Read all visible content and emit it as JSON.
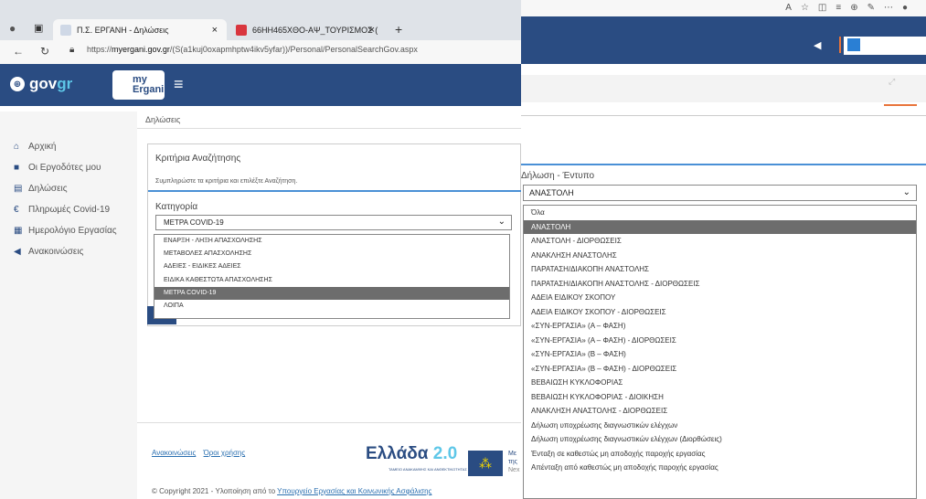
{
  "browser": {
    "tabs": [
      {
        "label": "Π.Σ. ΕΡΓΑΝΗ - Δηλώσεις"
      },
      {
        "label": "66ΗΗ465ΧΘΟ-ΑΨ_ΤΟΥΡΙΣΜΟΣ ("
      }
    ],
    "new_tab": "+",
    "url_prefix": "https://",
    "url_host": "myergani.gov.gr",
    "url_path": "/(S(a1kuj0oxapmhptw4ikv5yfar))/Personal/PersonalSearchGov.aspx"
  },
  "header": {
    "govgr_gov": "gov",
    "govgr_gr": "gr",
    "ergani_my": "my",
    "ergani_name": "Ergani"
  },
  "sidebar": {
    "items": [
      {
        "label": "Αρχική",
        "icon": "home-icon"
      },
      {
        "label": "Οι Εργοδότες μου",
        "icon": "briefcase-icon"
      },
      {
        "label": "Δηλώσεις",
        "icon": "document-icon"
      },
      {
        "label": "Πληρωμές Covid-19",
        "icon": "euro-icon"
      },
      {
        "label": "Ημερολόγιο Εργασίας",
        "icon": "calendar-icon"
      },
      {
        "label": "Ανακοινώσεις",
        "icon": "megaphone-icon"
      }
    ]
  },
  "breadcrumb": "Δηλώσεις",
  "search_panel": {
    "title": "Κριτήρια Αναζήτησης",
    "subtitle": "Συμπληρώστε τα κριτήρια και επιλέξτε Αναζήτηση.",
    "category_label": "Κατηγορία",
    "category_value": "ΜΕΤΡΑ COVID-19",
    "category_options": [
      "ΕΝΑΡΞΗ - ΛΗΞΗ ΑΠΑΣΧΟΛΗΣΗΣ",
      "ΜΕΤΑΒΟΛΕΣ ΑΠΑΣΧΟΛΗΣΗΣ",
      "ΑΔΕΙΕΣ - ΕΙΔΙΚΕΣ ΑΔΕΙΕΣ",
      "ΕΙΔΙΚΑ ΚΑΘΕΣΤΩΤΑ ΑΠΑΣΧΟΛΗΣΗΣ",
      "ΜΕΤΡΑ COVID-19",
      "ΛΟΙΠΑ"
    ],
    "category_selected_index": 4
  },
  "footer": {
    "link_announcements": "Ανακοινώσεις",
    "link_terms": "Όροι χρήσης",
    "ellada_word": "Ελλάδα",
    "ellada_num": "2.0",
    "ellada_sub": "ΤΑΜΕΙΟ ΑΝΑΚΑΜΨΗΣ ΚΑΙ ΑΝΘΕΚΤΙΚΟΤΗΤΑΣ",
    "eu_text_1": "Με",
    "eu_text_2": "της",
    "eu_text_3": "Nex",
    "copyright_text": "© Copyright 2021 - Υλοποίηση από το ",
    "copyright_link": "Υπουργείο Εργασίας και Κοινωνικής Ασφάλισης"
  },
  "right_form": {
    "label": "Δήλωση - Έντυπο",
    "value": "ΑΝΑΣΤΟΛΗ",
    "options": [
      "Όλα",
      "ΑΝΑΣΤΟΛΗ",
      "ΑΝΑΣΤΟΛΗ - ΔΙΟΡΘΩΣΕΙΣ",
      "ΑΝΑΚΛΗΣΗ ΑΝΑΣΤΟΛΗΣ",
      "ΠΑΡΑΤΑΣΗ/ΔΙΑΚΟΠΗ ΑΝΑΣΤΟΛΗΣ",
      "ΠΑΡΑΤΑΣΗ/ΔΙΑΚΟΠΗ ΑΝΑΣΤΟΛΗΣ - ΔΙΟΡΘΩΣΕΙΣ",
      "ΑΔΕΙΑ ΕΙΔΙΚΟΥ ΣΚΟΠΟΥ",
      "ΑΔΕΙΑ ΕΙΔΙΚΟΥ ΣΚΟΠΟΥ - ΔΙΟΡΘΩΣΕΙΣ",
      "«ΣΥΝ-ΕΡΓΑΣΙΑ» (Α – ΦΑΣΗ)",
      "«ΣΥΝ-ΕΡΓΑΣΙΑ» (Α – ΦΑΣΗ) - ΔΙΟΡΘΩΣΕΙΣ",
      "«ΣΥΝ-ΕΡΓΑΣΙΑ» (Β – ΦΑΣΗ)",
      "«ΣΥΝ-ΕΡΓΑΣΙΑ» (Β – ΦΑΣΗ) - ΔΙΟΡΘΩΣΕΙΣ",
      "ΒΕΒΑΙΩΣΗ ΚΥΚΛΟΦΟΡΙΑΣ",
      "ΒΕΒΑΙΩΣΗ ΚΥΚΛΟΦΟΡΙΑΣ - ΔΙΟΙΚΗΣΗ",
      "ΑΝΑΚΛΗΣΗ ΑΝΑΣΤΟΛΗΣ - ΔΙΟΡΘΩΣΕΙΣ",
      "Δήλωση υποχρέωσης διαγνωστικών ελέγχων",
      "Δήλωση υποχρέωσης διαγνωστικών ελέγχων (Διορθώσεις)",
      "Ένταξη σε καθεστώς μη αποδοχής παροχής εργασίας",
      "Απένταξη από καθεστώς μη αποδοχής παροχής εργασίας"
    ],
    "selected_index": 1
  },
  "colors": {
    "brand_blue": "#2a4c82",
    "accent_orange": "#e8743b",
    "selected_grey": "#6d6d6d",
    "focus_blue": "#4a90d6"
  }
}
